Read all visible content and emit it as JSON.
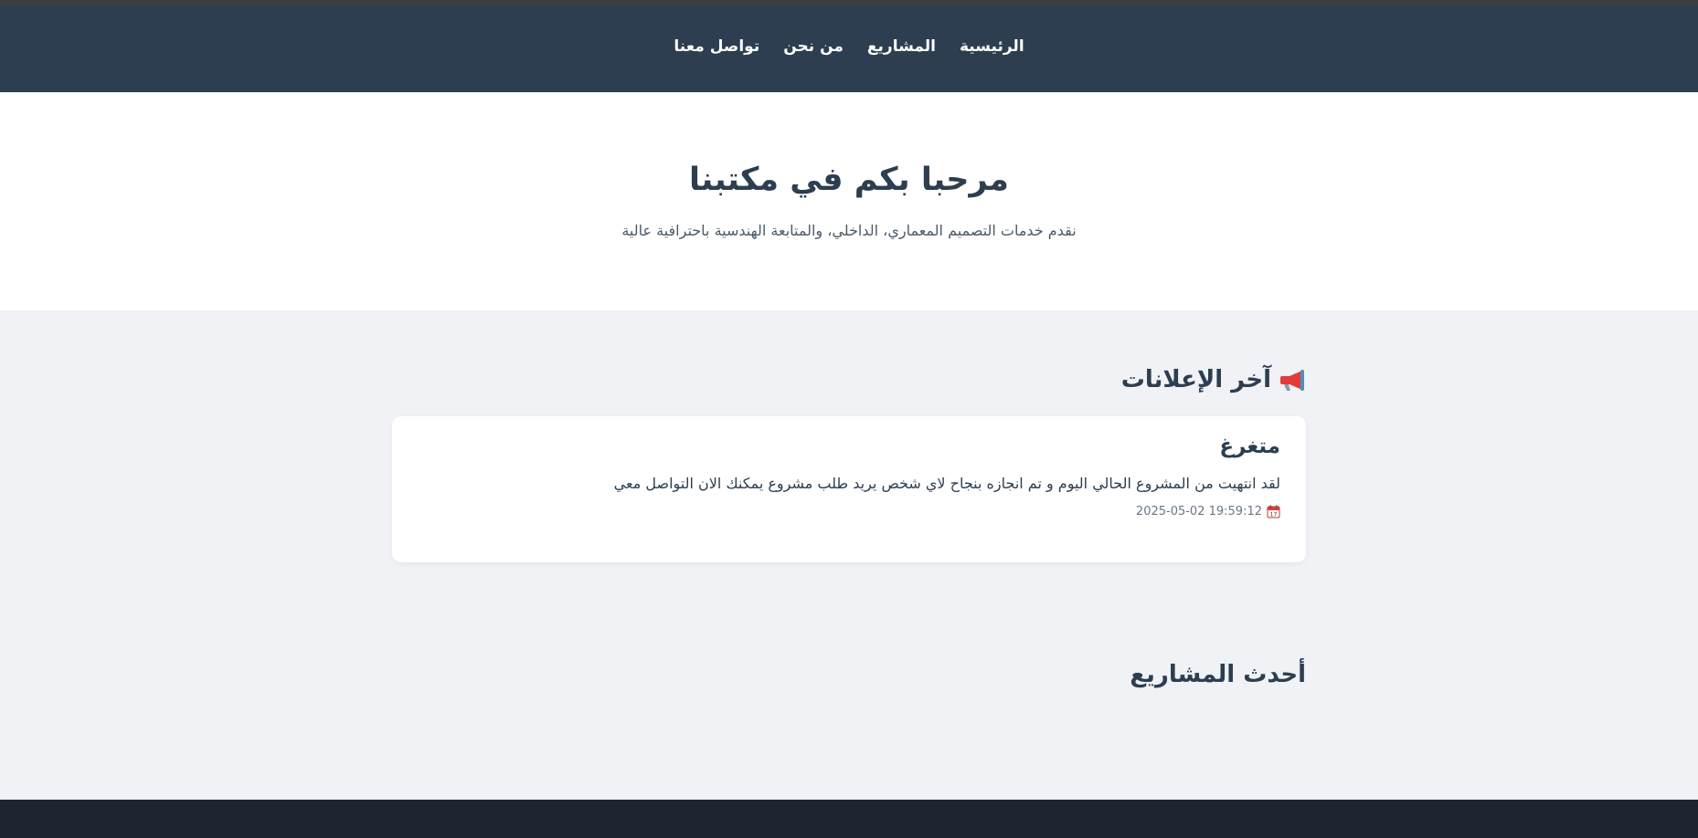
{
  "nav": {
    "items": [
      {
        "label": "الرئيسية"
      },
      {
        "label": "المشاريع"
      },
      {
        "label": "من نحن"
      },
      {
        "label": "تواصل معنا"
      }
    ]
  },
  "hero": {
    "title": "مرحبا بكم في مكتبنا",
    "subtitle": "نقدم خدمات التصميم المعماري، الداخلي، والمتابعة الهندسية باحترافية عالية"
  },
  "announcements": {
    "heading": "آخر الإعلانات",
    "icon": "megaphone-icon",
    "items": [
      {
        "title": "متغرغ",
        "body": "لقد انتهيت من المشروع الحالي اليوم و تم انجازه بنجاح لاي شخص يريد طلب مشروع يمكنك الان التواصل معي",
        "date": "2025-05-02 19:59:12",
        "date_icon": "calendar-icon"
      }
    ]
  },
  "projects": {
    "heading": "أحدث المشاريع"
  },
  "colors": {
    "navbar": "#2c3e50",
    "footer": "#1c2530",
    "page_bg": "#f0f2f5",
    "text": "#2c3e50"
  }
}
